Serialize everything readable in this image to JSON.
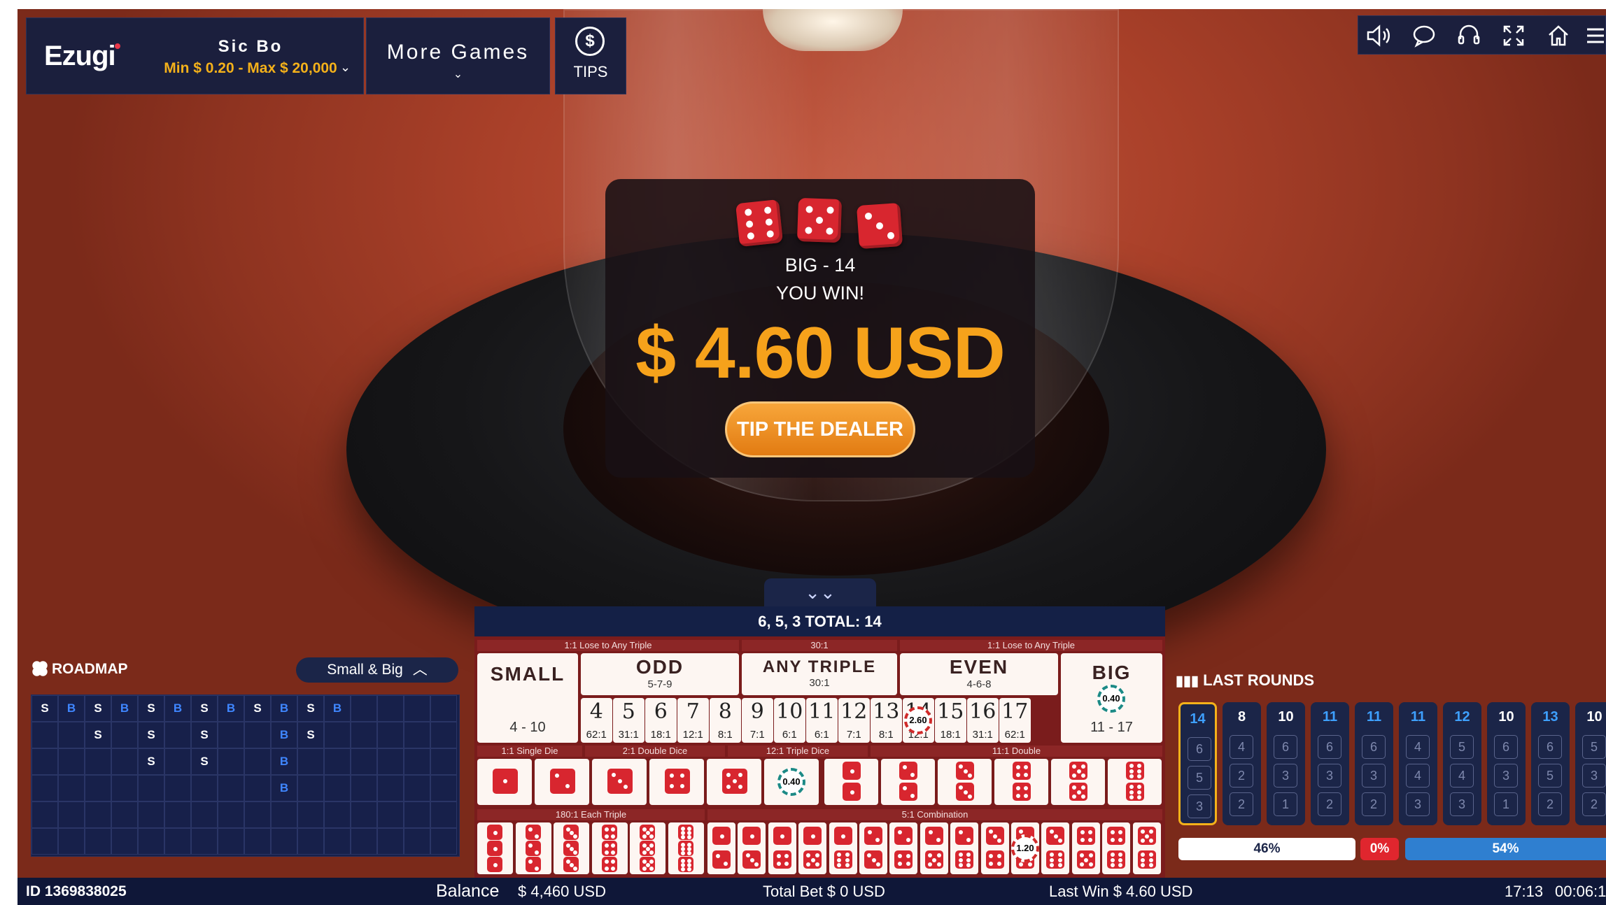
{
  "header": {
    "logo": "Ezugi",
    "game_name": "Sic Bo",
    "limits": "Min $ 0.20 - Max $ 20,000",
    "more_games": "More Games",
    "tips": "TIPS"
  },
  "toolbar": {
    "icons": [
      "sound-icon",
      "chat-icon",
      "support-icon",
      "fullscreen-icon",
      "home-icon",
      "menu-icon"
    ]
  },
  "win": {
    "result": "BIG - 14",
    "title": "YOU WIN!",
    "amount": "$ 4.60 USD",
    "tip_button": "TIP THE DEALER",
    "dice": [
      6,
      5,
      3
    ]
  },
  "board": {
    "result": "6, 5, 3 TOTAL: 14",
    "labels": {
      "small_lose": "1:1 Lose to Any Triple",
      "triple_odds": "30:1",
      "big_lose": "1:1 Lose to Any Triple",
      "single_die": "1:1 Single Die",
      "double_dice": "2:1 Double Dice",
      "triple_dice": "12:1 Triple Dice",
      "double": "11:1 Double",
      "each_triple": "180:1 Each Triple",
      "combination": "5:1 Combination"
    },
    "small": {
      "label": "SMALL",
      "range": "4 - 10"
    },
    "odd": {
      "label": "ODD",
      "nums": "5-7-9"
    },
    "any_triple": {
      "label": "ANY TRIPLE",
      "odds": "30:1"
    },
    "even": {
      "label": "EVEN",
      "nums": "4-6-8"
    },
    "big": {
      "label": "BIG",
      "range": "11 - 17",
      "chip": "0.40"
    },
    "totals": [
      {
        "n": "4",
        "p": "62:1"
      },
      {
        "n": "5",
        "p": "31:1"
      },
      {
        "n": "6",
        "p": "18:1"
      },
      {
        "n": "7",
        "p": "12:1"
      },
      {
        "n": "8",
        "p": "8:1"
      },
      {
        "n": "9",
        "p": "7:1"
      },
      {
        "n": "10",
        "p": "6:1"
      },
      {
        "n": "11",
        "p": "6:1"
      },
      {
        "n": "12",
        "p": "7:1"
      },
      {
        "n": "13",
        "p": "8:1"
      },
      {
        "n": "14",
        "p": "12:1"
      },
      {
        "n": "15",
        "p": "18:1"
      },
      {
        "n": "16",
        "p": "31:1"
      },
      {
        "n": "17",
        "p": "62:1"
      }
    ],
    "chip_total_14": "2.60",
    "chip_single": "0.40",
    "chip_combo": "1.20"
  },
  "roadmap": {
    "title": "ROADMAP",
    "toggle": "Small & Big",
    "columns": [
      [
        "S"
      ],
      [
        "B"
      ],
      [
        "S",
        "S"
      ],
      [
        "B"
      ],
      [
        "S",
        "S",
        "S"
      ],
      [
        "B"
      ],
      [
        "S",
        "S",
        "S"
      ],
      [
        "B"
      ],
      [
        "S"
      ],
      [
        "B",
        "B",
        "B",
        "B"
      ],
      [
        "S",
        "S"
      ],
      [
        "B"
      ]
    ]
  },
  "last_rounds": {
    "title": "LAST ROUNDS",
    "rounds": [
      {
        "total": "14",
        "dice": [
          "6",
          "5",
          "3"
        ]
      },
      {
        "total": "8",
        "dice": [
          "4",
          "2",
          "2"
        ]
      },
      {
        "total": "10",
        "dice": [
          "6",
          "3",
          "1"
        ]
      },
      {
        "total": "11",
        "dice": [
          "6",
          "3",
          "2"
        ]
      },
      {
        "total": "11",
        "dice": [
          "6",
          "3",
          "2"
        ]
      },
      {
        "total": "11",
        "dice": [
          "4",
          "4",
          "3"
        ]
      },
      {
        "total": "12",
        "dice": [
          "5",
          "4",
          "3"
        ]
      },
      {
        "total": "10",
        "dice": [
          "6",
          "3",
          "1"
        ]
      },
      {
        "total": "13",
        "dice": [
          "6",
          "5",
          "2"
        ]
      },
      {
        "total": "10",
        "dice": [
          "5",
          "3",
          "2"
        ]
      }
    ],
    "small_pct": "46%",
    "triple_pct": "0%",
    "big_pct": "54%",
    "colors": {
      "small": "#ffffff",
      "triple": "#e0262e",
      "big": "#2f7fd0"
    }
  },
  "status": {
    "id": "ID 1369838025",
    "balance_label": "Balance",
    "balance": "$ 4,460 USD",
    "total_bet": "Total Bet $ 0 USD",
    "last_win": "Last Win $ 4.60 USD",
    "time": "17:13",
    "timer": "00:06:1"
  }
}
